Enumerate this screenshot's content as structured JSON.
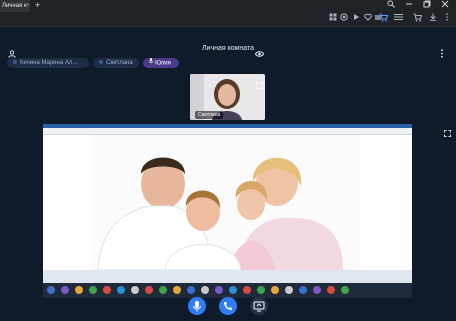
{
  "browser": {
    "tab_title": "Личная к",
    "tab_close": "×",
    "new_tab": "+",
    "window_controls": [
      "search-icon",
      "minimize-icon",
      "restore-icon",
      "close-icon"
    ],
    "toolbar_icons": [
      "grid-icon",
      "record-icon",
      "play-icon",
      "heart-icon",
      "extension-icon",
      "cart-icon",
      "menu-lines-icon",
      "cart-icon",
      "download-icon",
      "menu-icon"
    ]
  },
  "room": {
    "title": "Личная комната",
    "participants": [
      {
        "label": "Кечина Марина Ал...",
        "active": false
      },
      {
        "label": "Светлана",
        "active": false
      },
      {
        "label": "Юлия",
        "active": true
      }
    ],
    "thumbnail_name": "Светлана"
  },
  "controls": {
    "mic": "microphone-icon",
    "hangup": "phone-icon",
    "screen": "screen-share-icon"
  },
  "colors": {
    "background": "#0f1a2b",
    "accent": "#2f7cf6",
    "chip_active": "#4a3a8a"
  }
}
